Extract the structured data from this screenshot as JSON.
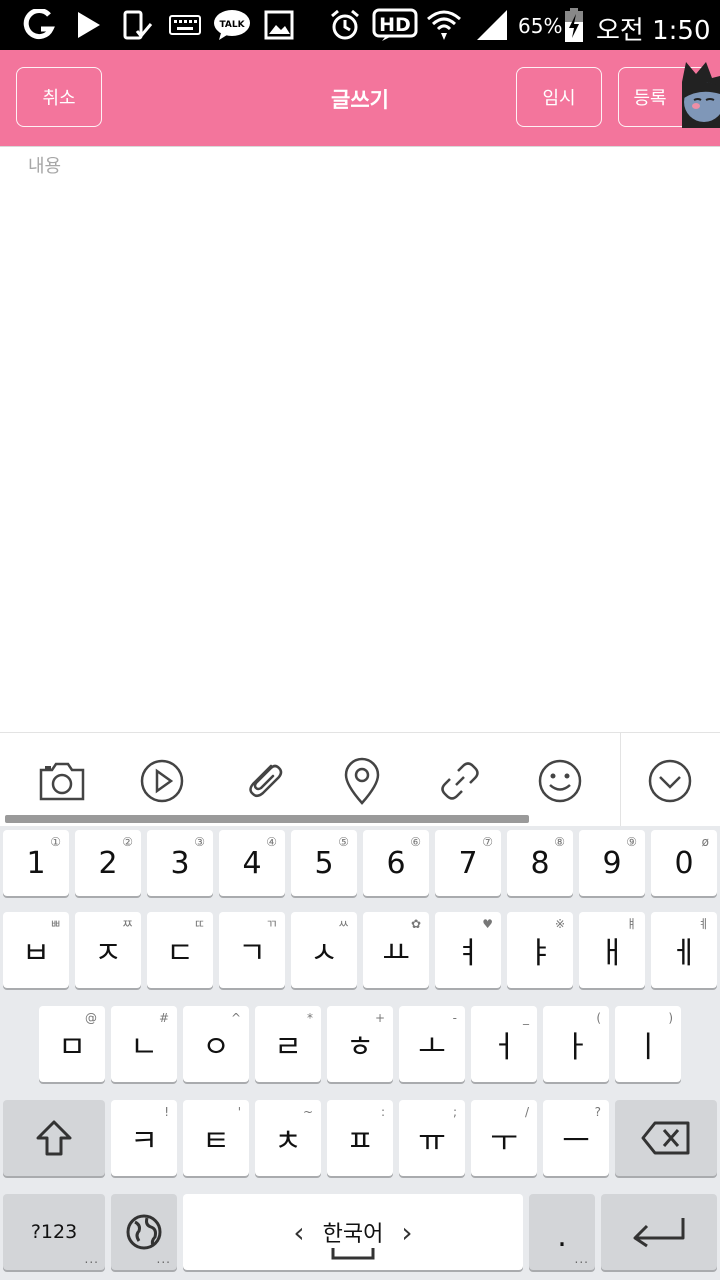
{
  "status_bar": {
    "battery_percent": "65%",
    "time": "오전 1:50",
    "icons": [
      "olleh-icon",
      "play-store-icon",
      "phone-check-icon",
      "keyboard-icon",
      "kakaotalk-icon",
      "image-icon",
      "alarm-icon",
      "hd-icon",
      "wifi-icon",
      "signal-icon",
      "battery-charging-icon"
    ],
    "talk_label": "TALK",
    "hd_label": "HD"
  },
  "header": {
    "cancel_label": "취소",
    "title": "글쓰기",
    "temp_label": "임시",
    "submit_label": "등록",
    "color": "#f3759c"
  },
  "editor": {
    "placeholder": "내용"
  },
  "toolbar": {
    "tools": [
      "camera-icon",
      "video-icon",
      "attachment-icon",
      "location-icon",
      "link-icon",
      "emoji-icon",
      "collapse-icon"
    ]
  },
  "keyboard": {
    "row1": [
      {
        "main": "1",
        "hint": "①"
      },
      {
        "main": "2",
        "hint": "②"
      },
      {
        "main": "3",
        "hint": "③"
      },
      {
        "main": "4",
        "hint": "④"
      },
      {
        "main": "5",
        "hint": "⑤"
      },
      {
        "main": "6",
        "hint": "⑥"
      },
      {
        "main": "7",
        "hint": "⑦"
      },
      {
        "main": "8",
        "hint": "⑧"
      },
      {
        "main": "9",
        "hint": "⑨"
      },
      {
        "main": "0",
        "hint": "ø"
      }
    ],
    "row2": [
      {
        "main": "ㅂ",
        "hint": "ㅃ"
      },
      {
        "main": "ㅈ",
        "hint": "ㅉ"
      },
      {
        "main": "ㄷ",
        "hint": "ㄸ"
      },
      {
        "main": "ㄱ",
        "hint": "ㄲ"
      },
      {
        "main": "ㅅ",
        "hint": "ㅆ"
      },
      {
        "main": "ㅛ",
        "hint": "✿"
      },
      {
        "main": "ㅕ",
        "hint": "♥"
      },
      {
        "main": "ㅑ",
        "hint": "※"
      },
      {
        "main": "ㅐ",
        "hint": "ㅒ"
      },
      {
        "main": "ㅔ",
        "hint": "ㅖ"
      }
    ],
    "row3": [
      {
        "main": "ㅁ",
        "hint": "@"
      },
      {
        "main": "ㄴ",
        "hint": "#"
      },
      {
        "main": "ㅇ",
        "hint": "^"
      },
      {
        "main": "ㄹ",
        "hint": "*"
      },
      {
        "main": "ㅎ",
        "hint": "+"
      },
      {
        "main": "ㅗ",
        "hint": "-"
      },
      {
        "main": "ㅓ",
        "hint": "_"
      },
      {
        "main": "ㅏ",
        "hint": "("
      },
      {
        "main": "ㅣ",
        "hint": ")"
      }
    ],
    "row4": [
      {
        "main": "ㅋ",
        "hint": "!"
      },
      {
        "main": "ㅌ",
        "hint": "'"
      },
      {
        "main": "ㅊ",
        "hint": "~"
      },
      {
        "main": "ㅍ",
        "hint": ":"
      },
      {
        "main": "ㅠ",
        "hint": ";"
      },
      {
        "main": "ㅜ",
        "hint": "/"
      },
      {
        "main": "ㅡ",
        "hint": "?"
      }
    ],
    "symbols_label": "?123",
    "language_label": "한국어",
    "period_label": ".",
    "dots": "...",
    "lang_left": "‹",
    "lang_right": "›"
  }
}
